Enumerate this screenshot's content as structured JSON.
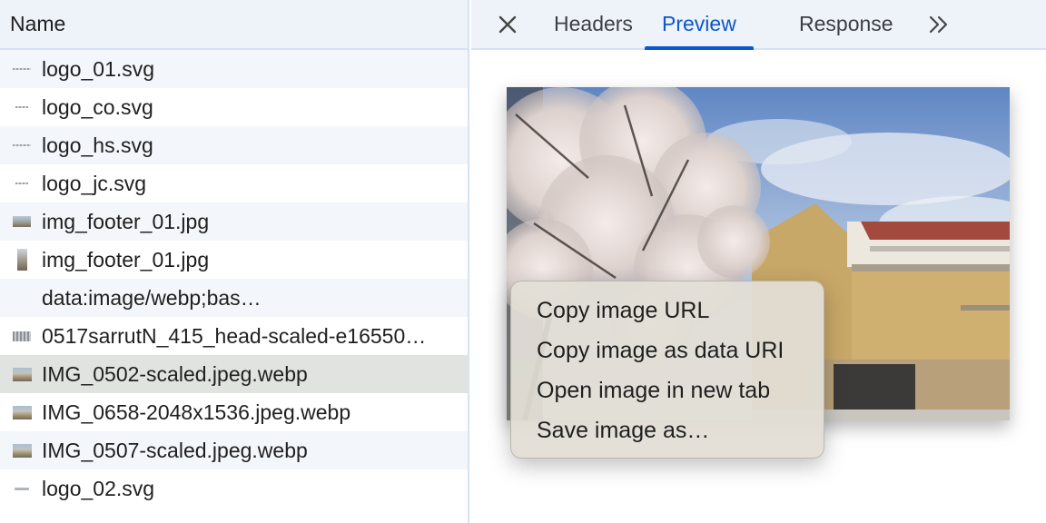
{
  "requests": {
    "header": "Name",
    "files": [
      {
        "name": "logo_01.svg",
        "thumb": "svg-line"
      },
      {
        "name": "logo_co.svg",
        "thumb": "svg-line"
      },
      {
        "name": "logo_hs.svg",
        "thumb": "svg-line"
      },
      {
        "name": "logo_jc.svg",
        "thumb": "svg-line"
      },
      {
        "name": "img_footer_01.jpg",
        "thumb": "image"
      },
      {
        "name": "img_footer_01.jpg",
        "thumb": "tall-image"
      },
      {
        "name": "data:image/webp;bas…",
        "thumb": "none"
      },
      {
        "name": "0517sarrutN_415_head-scaled-e16550…",
        "thumb": "mosaic"
      },
      {
        "name": "IMG_0502-scaled.jpeg.webp",
        "thumb": "photo",
        "selected": true
      },
      {
        "name": "IMG_0658-2048x1536.jpeg.webp",
        "thumb": "photo"
      },
      {
        "name": "IMG_0507-scaled.jpeg.webp",
        "thumb": "photo"
      },
      {
        "name": "logo_02.svg",
        "thumb": "svg-tiny"
      }
    ]
  },
  "detail": {
    "tabs": {
      "headers": "Headers",
      "preview": "Preview",
      "response": "Response"
    },
    "active_tab": "Preview",
    "close_icon": "close-icon",
    "more_icon": "chevron-double-right-icon"
  },
  "context_menu": {
    "copy_url": "Copy image URL",
    "copy_data_uri": "Copy image as data URI",
    "open_new_tab": "Open image in new tab",
    "save_as": "Save image as…"
  },
  "colors": {
    "accent": "#0b57d0",
    "header_bg": "#eef2f9",
    "border": "#d6e2f5",
    "selected_row": "#e1e3e1"
  }
}
